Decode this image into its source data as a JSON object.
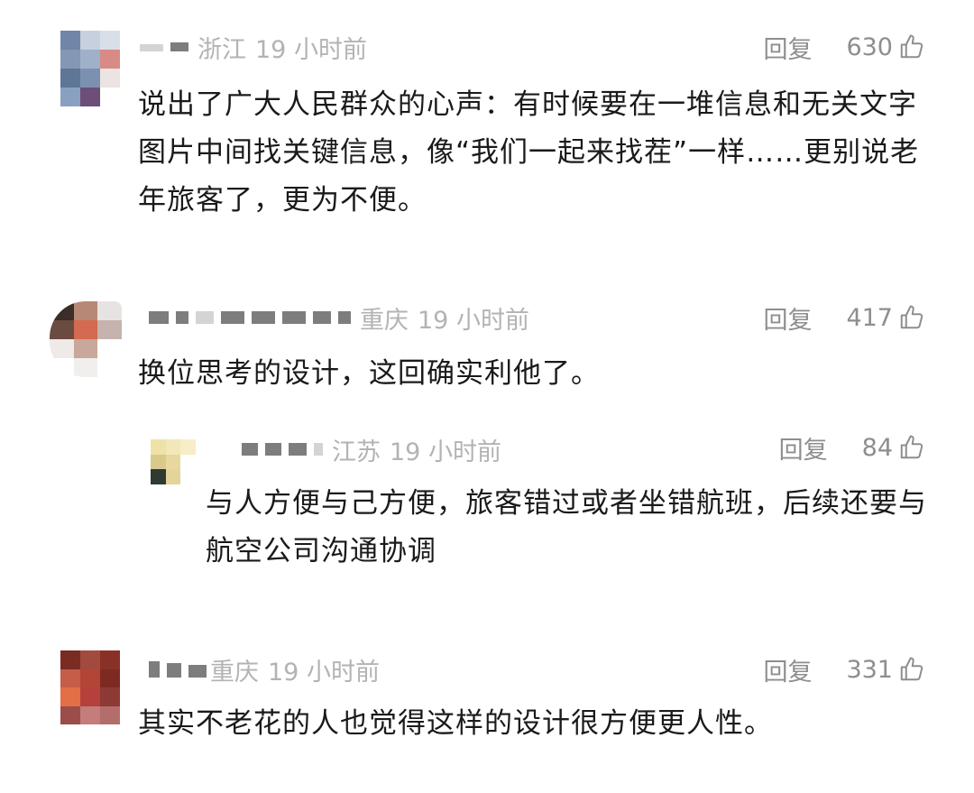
{
  "comments": [
    {
      "location": "浙江",
      "time": "19 小时前",
      "reply_label": "回复",
      "likes": "630",
      "text": "说出了广大人民群众的心声：有时候要在一堆信息和无关文字图片中间找关键信息，像“我们一起来找茬”一样……更别说老年旅客了，更为不便。"
    },
    {
      "location": "重庆",
      "time": "19 小时前",
      "reply_label": "回复",
      "likes": "417",
      "text": "换位思考的设计，这回确实利他了。",
      "reply": {
        "location": "江苏",
        "time": "19 小时前",
        "reply_label": "回复",
        "likes": "84",
        "text": "与人方便与己方便，旅客错过或者坐错航班，后续还要与航空公司沟通协调"
      }
    },
    {
      "location": "重庆",
      "time": "19 小时前",
      "reply_label": "回复",
      "likes": "331",
      "text": "其实不老花的人也觉得这样的设计很方便更人性。"
    }
  ],
  "colors": {
    "meta_text": "#b3b3b3",
    "action_text": "#8e8e8e",
    "body_text": "#1a1a1a"
  },
  "icons": [
    "thumbs-up-icon",
    "avatar-image"
  ]
}
